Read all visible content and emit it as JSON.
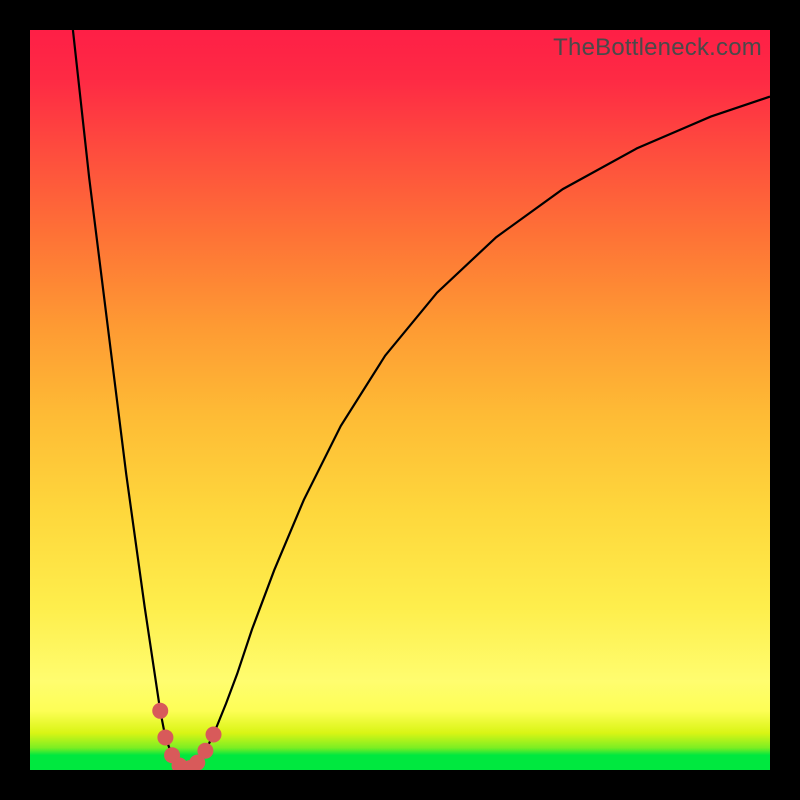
{
  "watermark": "TheBottleneck.com",
  "chart_data": {
    "type": "line",
    "title": "",
    "xlabel": "",
    "ylabel": "",
    "xlim": [
      0,
      100
    ],
    "ylim": [
      0,
      100
    ],
    "grid": false,
    "annotations": [],
    "curve_points": [
      {
        "x": 5.8,
        "y": 100.0
      },
      {
        "x": 8.0,
        "y": 80.0
      },
      {
        "x": 10.5,
        "y": 60.0
      },
      {
        "x": 13.0,
        "y": 40.0
      },
      {
        "x": 15.5,
        "y": 22.0
      },
      {
        "x": 17.0,
        "y": 12.0
      },
      {
        "x": 17.6,
        "y": 8.0
      },
      {
        "x": 18.3,
        "y": 4.4
      },
      {
        "x": 19.2,
        "y": 2.0
      },
      {
        "x": 20.2,
        "y": 0.6
      },
      {
        "x": 21.0,
        "y": 0.2
      },
      {
        "x": 21.6,
        "y": 0.25
      },
      {
        "x": 22.6,
        "y": 1.0
      },
      {
        "x": 23.7,
        "y": 2.6
      },
      {
        "x": 24.8,
        "y": 4.8
      },
      {
        "x": 26.5,
        "y": 9.0
      },
      {
        "x": 28.0,
        "y": 13.0
      },
      {
        "x": 30.0,
        "y": 19.0
      },
      {
        "x": 33.0,
        "y": 27.0
      },
      {
        "x": 37.0,
        "y": 36.5
      },
      {
        "x": 42.0,
        "y": 46.5
      },
      {
        "x": 48.0,
        "y": 56.0
      },
      {
        "x": 55.0,
        "y": 64.5
      },
      {
        "x": 63.0,
        "y": 72.0
      },
      {
        "x": 72.0,
        "y": 78.5
      },
      {
        "x": 82.0,
        "y": 84.0
      },
      {
        "x": 92.0,
        "y": 88.3
      },
      {
        "x": 100.0,
        "y": 91.0
      }
    ],
    "markers": [
      {
        "x": 17.6,
        "y": 8.0
      },
      {
        "x": 18.3,
        "y": 4.4
      },
      {
        "x": 19.2,
        "y": 2.0
      },
      {
        "x": 20.2,
        "y": 0.6
      },
      {
        "x": 21.6,
        "y": 0.25
      },
      {
        "x": 22.6,
        "y": 1.0
      },
      {
        "x": 23.7,
        "y": 2.6
      },
      {
        "x": 24.8,
        "y": 4.8
      }
    ],
    "colors": {
      "curve": "#000000",
      "marker": "#d85a5a",
      "gradient_top": "#fe1f46",
      "gradient_mid": "#fedb3a",
      "gradient_bottom": "#00e83f",
      "frame": "#000000"
    }
  }
}
